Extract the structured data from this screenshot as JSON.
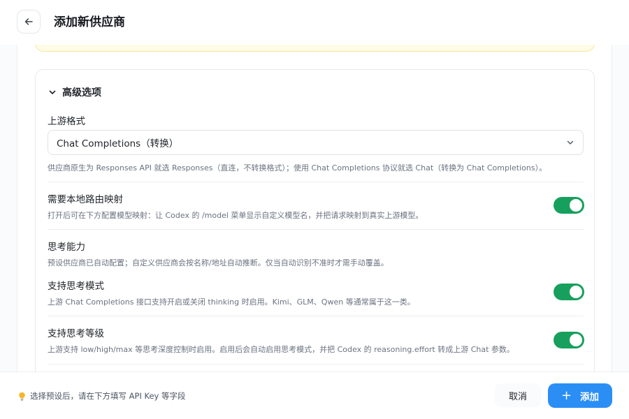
{
  "header": {
    "title": "添加新供应商",
    "back_icon": "arrow-left-icon"
  },
  "advanced": {
    "title": "高级选项",
    "upstream_format": {
      "label": "上游格式",
      "selected": "Chat Completions（转换）",
      "hint": "供应商原生为 Responses API 就选 Responses（直连，不转换格式）；使用 Chat Completions 协议就选 Chat（转换为 Chat Completions）。"
    },
    "local_routing": {
      "label": "需要本地路由映射",
      "hint": "打开后可在下方配置模型映射：让 Codex 的 /model 菜单显示自定义模型名，并把请求映射到真实上游模型。",
      "enabled": true
    },
    "thinking_capability": {
      "label": "思考能力",
      "hint": "预设供应商已自动配置；自定义供应商会按名称/地址自动推断。仅当自动识别不准时才需手动覆盖。"
    },
    "thinking_mode": {
      "label": "支持思考模式",
      "hint": "上游 Chat Completions 接口支持开启或关闭 thinking 时启用。Kimi、GLM、Qwen 等通常属于这一类。",
      "enabled": true
    },
    "thinking_level": {
      "label": "支持思考等级",
      "hint": "上游支持 low/high/max 等思考深度控制时启用。启用后会自动启用思考模式，并把 Codex 的 reasoning.effort 转成上游 Chat 参数。",
      "enabled": true
    }
  },
  "footer": {
    "hint": "选择预设后，请在下方填写 API Key 等字段",
    "cancel_label": "取消",
    "add_label": "添加"
  },
  "colors": {
    "accent": "#2b8ef5",
    "toggle_on": "#17a05d",
    "warn_bg": "#fffbe6"
  }
}
